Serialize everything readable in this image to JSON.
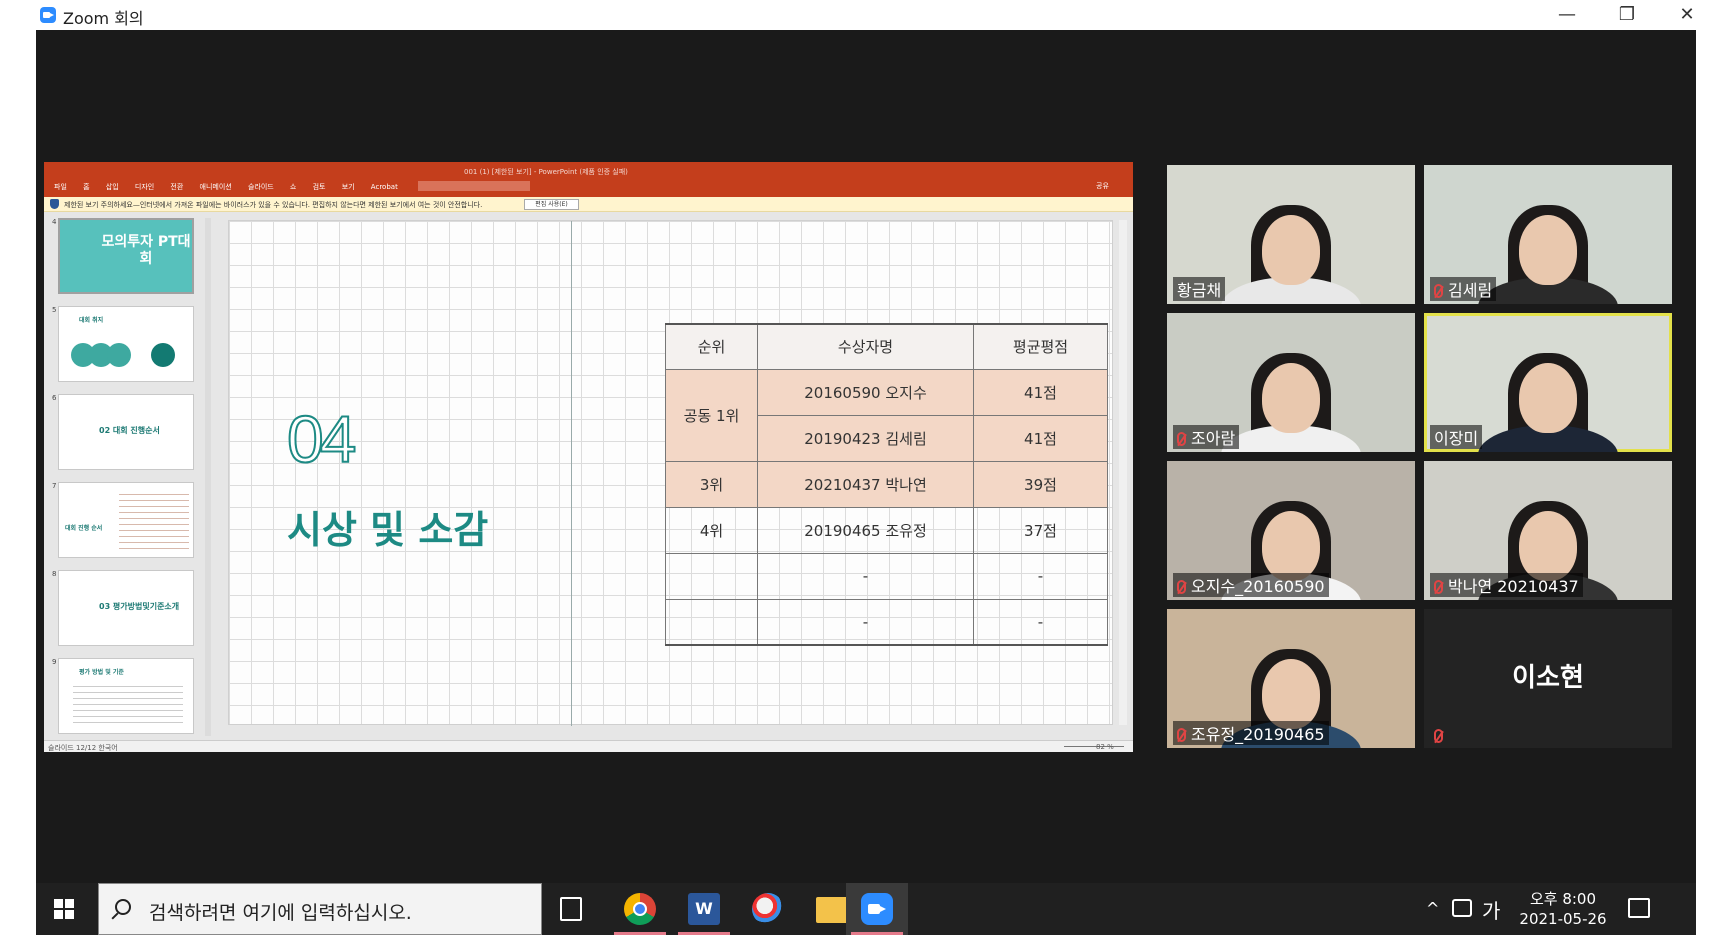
{
  "window": {
    "title": "Zoom 회의",
    "buttons": [
      "—",
      "❐",
      "✕"
    ]
  },
  "powerpoint": {
    "doc_title": "001 (1) [제한된 보기] - PowerPoint (제품 인증 실패)",
    "menu": "파일 홈 삽입 디자인 전환 애니메이션 슬라이드 쇼 검토 보기 Acrobat",
    "share": "공유",
    "warning": "제한된 보기   주의하세요—인터넷에서 가져온 파일에는 바이러스가 있을 수 있습니다. 편집하지 않는다면 제한된 보기에서 여는 것이 안전합니다.",
    "edit_button": "편집 사용(E)",
    "status_left": "슬라이드 12/12    한국어",
    "zoom": "82 %",
    "thumbnails": [
      {
        "num": "4",
        "title": "모의투자 PT대회"
      },
      {
        "num": "5",
        "title": "대회 취지"
      },
      {
        "num": "6",
        "title": "02 대회 진행순서"
      },
      {
        "num": "7",
        "title": "대회 진행 순서"
      },
      {
        "num": "8",
        "title": "03 평가방법및기준소개"
      },
      {
        "num": "9",
        "title": "평가 방법 및 기준"
      }
    ],
    "slide": {
      "number": "04",
      "headline": "시상 및 소감",
      "table": {
        "headers": [
          "순위",
          "수상자명",
          "평균평점"
        ],
        "rows": [
          [
            "공동 1위",
            "20160590 오지수",
            "41점"
          ],
          [
            "",
            "20190423 김세림",
            "41점"
          ],
          [
            "3위",
            "20210437 박나연",
            "39점"
          ],
          [
            "4위",
            "20190465 조유정",
            "37점"
          ],
          [
            "",
            "-",
            "-"
          ],
          [
            "",
            "-",
            "-"
          ]
        ]
      }
    }
  },
  "participants": [
    {
      "name": "황금채",
      "muted": false,
      "active": false,
      "bg": "#d6d8cf",
      "shirt": "#e8e8e8"
    },
    {
      "name": "김세림",
      "muted": true,
      "active": false,
      "bg": "#cfd6cf",
      "shirt": "#2a2a2a"
    },
    {
      "name": "조아람",
      "muted": true,
      "active": false,
      "bg": "#c9ccc4",
      "shirt": "#f0f0f0"
    },
    {
      "name": "이장미",
      "muted": false,
      "active": true,
      "bg": "#d7dbd3",
      "shirt": "#1d2636"
    },
    {
      "name": "오지수_20160590",
      "muted": true,
      "active": false,
      "bg": "#b9b2a8",
      "shirt": "#f3f3f3"
    },
    {
      "name": "박나연 20210437",
      "muted": true,
      "active": false,
      "bg": "#cfcfc8",
      "shirt": "#333333"
    },
    {
      "name": "조유정_20190465",
      "muted": true,
      "active": false,
      "bg": "#c9b49a",
      "shirt": "#2c4c6c"
    },
    {
      "name": "이소현",
      "muted": true,
      "active": false,
      "bg": "#232323",
      "shirt": ""
    }
  ],
  "taskbar": {
    "search_placeholder": "검색하려면 여기에 입력하십시오.",
    "ime": "가",
    "time": "오후 8:00",
    "date": "2021-05-26"
  }
}
